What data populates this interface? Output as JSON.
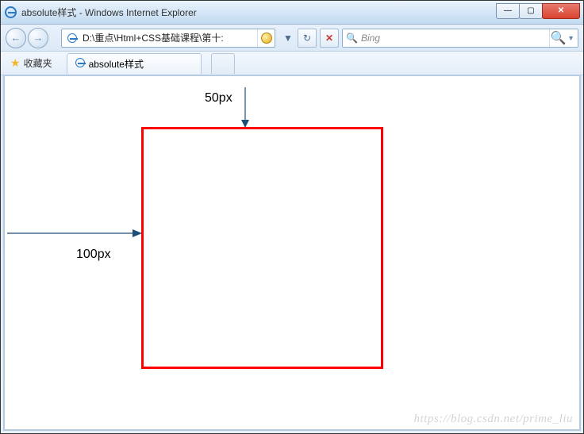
{
  "titlebar": {
    "title": "absolute样式 - Windows Internet Explorer"
  },
  "navbar": {
    "address": "D:\\重点\\Html+CSS基础课程\\第十:",
    "search_placeholder": "Bing"
  },
  "favbar": {
    "fav_label": "收藏夹"
  },
  "tab": {
    "label": "absolute样式"
  },
  "content": {
    "top_label": "50px",
    "left_label": "100px"
  },
  "watermark": "https://blog.csdn.net/prime_liu",
  "controls": {
    "back": "←",
    "forward": "→",
    "dropdown": "▼",
    "refresh": "↻",
    "stop": "✕",
    "search": "🔍",
    "min": "—",
    "max": "▢",
    "close": "✕"
  }
}
